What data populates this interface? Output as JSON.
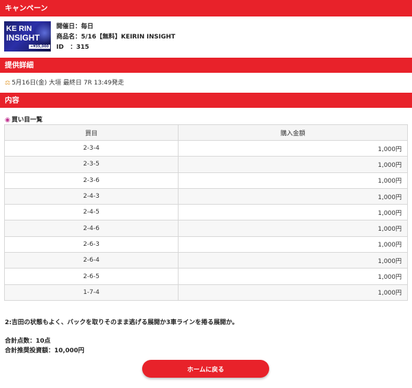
{
  "sections": {
    "campaign": "キャンペーン",
    "detail": "提供詳細",
    "content": "内容"
  },
  "campaign": {
    "thumbnail": {
      "line1": "KE RIN",
      "line2": "INSIGHT",
      "badge": "+¥35,000"
    },
    "date_label": "開催日：",
    "date_value": "毎日",
    "product_label": "商品名：",
    "product_value": "5/16【無料】KEIRIN INSIGHT",
    "id_label": "ID",
    "id_value": "：315"
  },
  "detail": {
    "icon": "bike-icon",
    "text": "5月16日(金) 大垣 最終日 7R 13:49発走"
  },
  "buy_list": {
    "title": "買い目一覧",
    "icon": "target-icon",
    "headers": [
      "買目",
      "購入金額"
    ],
    "rows": [
      {
        "combo": "2-3-4",
        "amount": "1,000円"
      },
      {
        "combo": "2-3-5",
        "amount": "1,000円"
      },
      {
        "combo": "2-3-6",
        "amount": "1,000円"
      },
      {
        "combo": "2-4-3",
        "amount": "1,000円"
      },
      {
        "combo": "2-4-5",
        "amount": "1,000円"
      },
      {
        "combo": "2-4-6",
        "amount": "1,000円"
      },
      {
        "combo": "2-6-3",
        "amount": "1,000円"
      },
      {
        "combo": "2-6-4",
        "amount": "1,000円"
      },
      {
        "combo": "2-6-5",
        "amount": "1,000円"
      },
      {
        "combo": "1-7-4",
        "amount": "1,000円"
      }
    ]
  },
  "comment": "2:吉田の状態もよく、バックを取りそのまま逃げる展開か3車ラインを捲る展開か。",
  "totals": {
    "points": "合計点数：10点",
    "amount": "合計推奨投資額：10,000円"
  },
  "home_button": "ホームに戻る",
  "colors": {
    "accent": "#e8222a"
  }
}
